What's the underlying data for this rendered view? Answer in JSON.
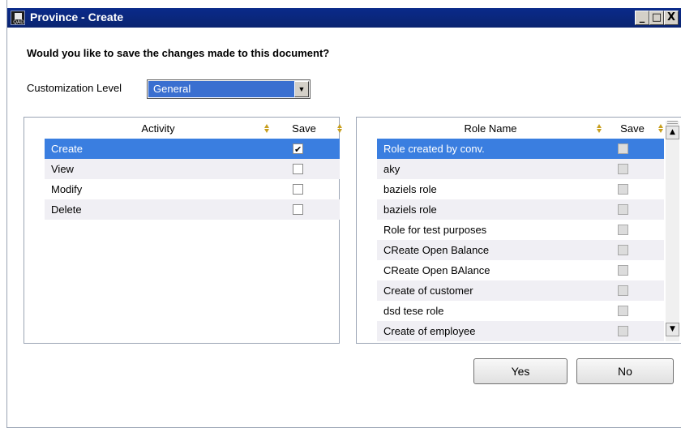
{
  "window": {
    "title": "Province - Create",
    "app_icon_label": "QAD",
    "controls": {
      "minimize": "_",
      "maximize": "□",
      "close": "X"
    }
  },
  "dialog": {
    "question": "Would you like to save the changes made to this document?",
    "customization": {
      "label": "Customization Level",
      "value": "General"
    }
  },
  "activity_grid": {
    "headers": {
      "activity": "Activity",
      "save": "Save"
    },
    "rows": [
      {
        "activity": "Create",
        "save": true,
        "selected": true
      },
      {
        "activity": "View",
        "save": false,
        "selected": false
      },
      {
        "activity": "Modify",
        "save": false,
        "selected": false
      },
      {
        "activity": "Delete",
        "save": false,
        "selected": false
      }
    ]
  },
  "role_grid": {
    "headers": {
      "role_name": "Role Name",
      "save": "Save"
    },
    "rows": [
      {
        "role_name": "Role created by conv.",
        "save": false,
        "selected": true
      },
      {
        "role_name": "aky",
        "save": false,
        "selected": false
      },
      {
        "role_name": "baziels role",
        "save": false,
        "selected": false
      },
      {
        "role_name": "baziels role",
        "save": false,
        "selected": false
      },
      {
        "role_name": "Role for test purposes",
        "save": false,
        "selected": false
      },
      {
        "role_name": "CReate Open Balance",
        "save": false,
        "selected": false
      },
      {
        "role_name": "CReate Open BAlance",
        "save": false,
        "selected": false
      },
      {
        "role_name": "Create of customer",
        "save": false,
        "selected": false
      },
      {
        "role_name": "dsd tese role",
        "save": false,
        "selected": false
      },
      {
        "role_name": "Create of employee",
        "save": false,
        "selected": false
      }
    ]
  },
  "buttons": {
    "yes": "Yes",
    "no": "No"
  },
  "colors": {
    "titlebar": "#0a2a8a",
    "selection": "#3a7ee0",
    "alt_row": "#f0eff4"
  }
}
